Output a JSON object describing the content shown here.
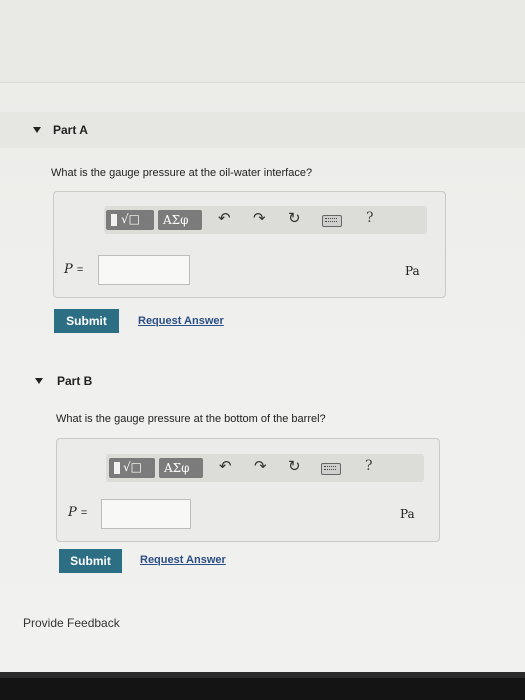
{
  "parts": [
    {
      "title": "Part A",
      "question": "What is the gauge pressure at the oil-water interface?",
      "toolbar": {
        "templates_icon": "templates-radical-icon",
        "radical": "√□",
        "symbols": "ΑΣφ",
        "undo_icon": "↶",
        "redo_icon": "↷",
        "reset_icon": "↻",
        "keyboard_icon": "keyboard-icon",
        "help": "?"
      },
      "variable": "P",
      "equals": "=",
      "input_value": "",
      "unit": "Pa",
      "submit_label": "Submit",
      "request_label": "Request Answer"
    },
    {
      "title": "Part B",
      "question": "What is the gauge pressure at the bottom of the barrel?",
      "toolbar": {
        "templates_icon": "templates-radical-icon",
        "radical": "√□",
        "symbols": "ΑΣφ",
        "undo_icon": "↶",
        "redo_icon": "↷",
        "reset_icon": "↻",
        "keyboard_icon": "keyboard-icon",
        "help": "?"
      },
      "variable": "P",
      "equals": "=",
      "input_value": "",
      "unit": "Pa",
      "submit_label": "Submit",
      "request_label": "Request Answer"
    }
  ],
  "feedback_label": "Provide Feedback",
  "colors": {
    "accent": "#2c6e83",
    "link": "#2b4f86",
    "toolbar_group": "#7b7b7b"
  }
}
